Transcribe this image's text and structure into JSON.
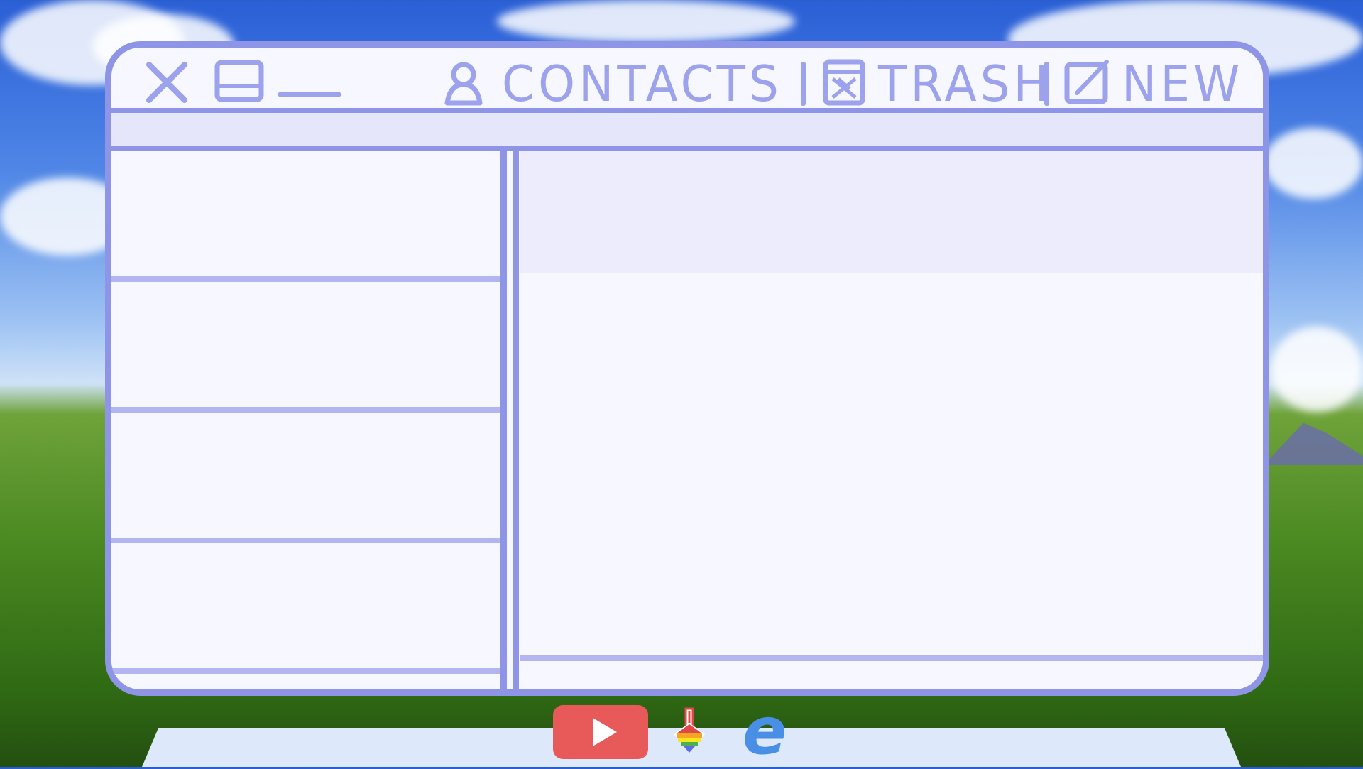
{
  "window": {
    "controls": [
      "close-icon",
      "maximize-icon",
      "minimize-icon"
    ],
    "menu": {
      "contacts": "CONTACTS",
      "trash": "TRASH",
      "new": "NEW"
    }
  },
  "message_list": {
    "items": [
      {},
      {},
      {},
      {}
    ]
  },
  "taskbar": {
    "apps": [
      "youtube-icon",
      "download-tool-icon",
      "edge-browser-icon"
    ]
  },
  "colors": {
    "accent": "#8f95e6",
    "panel_bg": "#f6f7ff",
    "toolbar_bg": "#e6e6fa",
    "taskbar_bg": "#dde9fb",
    "youtube_red": "#e85a5a",
    "edge_blue": "#4a8fe6"
  }
}
